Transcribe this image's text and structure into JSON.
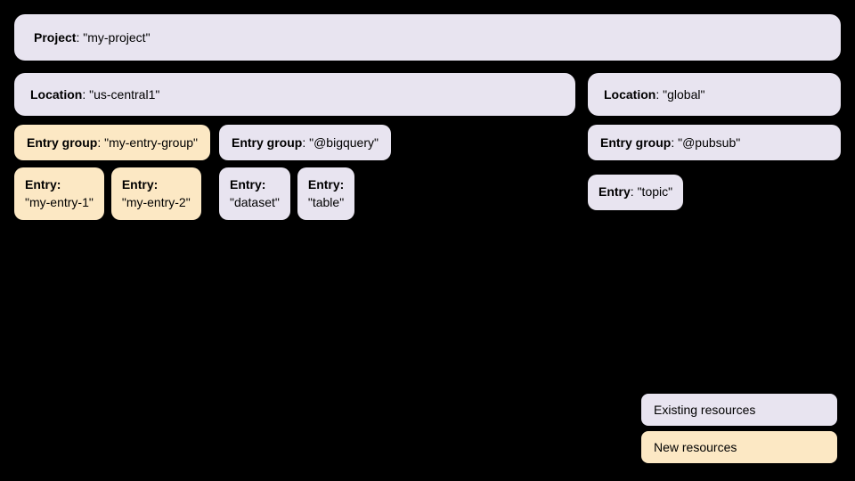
{
  "project": {
    "label": "Project",
    "value": "\"my-project\""
  },
  "locations": [
    {
      "id": "us-central1",
      "label": "Location",
      "value": "\"us-central1\"",
      "entryGroups": [
        {
          "id": "my-entry-group",
          "label": "Entry group",
          "value": "\"my-entry-group\"",
          "type": "new-resource",
          "entries": [
            {
              "label": "Entry",
              "value": "\"my-entry-1\"",
              "type": "new-resource"
            },
            {
              "label": "Entry",
              "value": "\"my-entry-2\"",
              "type": "new-resource"
            }
          ]
        },
        {
          "id": "bigquery",
          "label": "Entry group",
          "value": "\"@bigquery\"",
          "type": "existing",
          "entries": [
            {
              "label": "Entry",
              "value": "\"dataset\"",
              "type": "existing"
            },
            {
              "label": "Entry",
              "value": "\"table\"",
              "type": "existing"
            }
          ]
        }
      ]
    },
    {
      "id": "global",
      "label": "Location",
      "value": "\"global\"",
      "entryGroups": [
        {
          "id": "pubsub",
          "label": "Entry group",
          "value": "\"@pubsub\"",
          "type": "existing",
          "entries": [
            {
              "label": "Entry",
              "value": "\"topic\"",
              "type": "existing"
            }
          ]
        }
      ]
    }
  ],
  "legend": {
    "existing": {
      "label": "Existing resources"
    },
    "new": {
      "label": "New resources"
    }
  }
}
